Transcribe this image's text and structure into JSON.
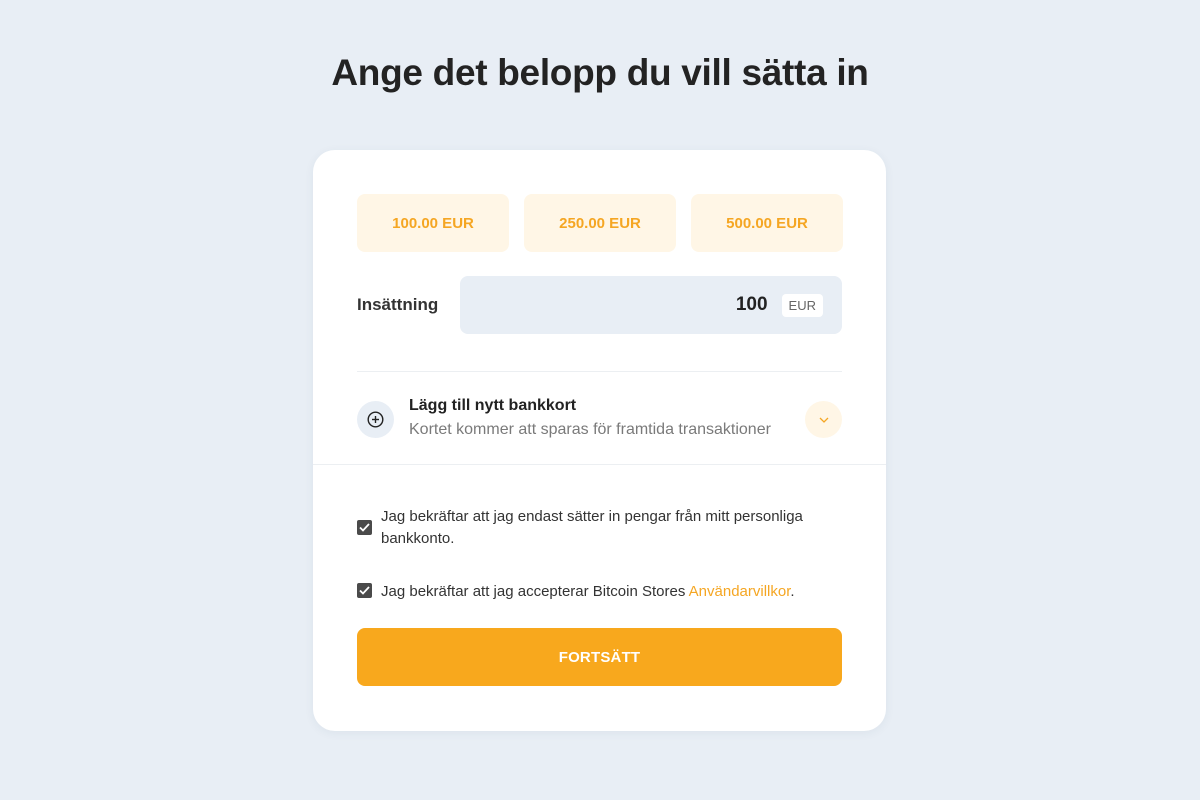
{
  "page": {
    "title": "Ange det belopp du vill sätta in"
  },
  "presets": [
    {
      "label": "100.00 EUR"
    },
    {
      "label": "250.00 EUR"
    },
    {
      "label": "500.00 EUR"
    }
  ],
  "deposit": {
    "label": "Insättning",
    "value": "100",
    "currency": "EUR"
  },
  "bank_card": {
    "title": "Lägg till nytt bankkort",
    "subtitle": "Kortet kommer att sparas för framtida transaktioner",
    "icon": "plus-circle-icon",
    "expand_icon": "chevron-down-icon"
  },
  "confirmations": [
    {
      "text": "Jag bekräftar att jag endast sätter in pengar från mitt personliga bankkonto.",
      "checked": true
    },
    {
      "text_before": "Jag bekräftar att jag accepterar Bitcoin Stores ",
      "link": "Användarvillkor",
      "text_after": ".",
      "checked": true
    }
  ],
  "actions": {
    "continue_label": "FORTSÄTT"
  },
  "colors": {
    "accent": "#f8a81d",
    "accent_text": "#f5a623",
    "preset_bg": "#fff6e6",
    "page_bg": "#e8eef5"
  }
}
